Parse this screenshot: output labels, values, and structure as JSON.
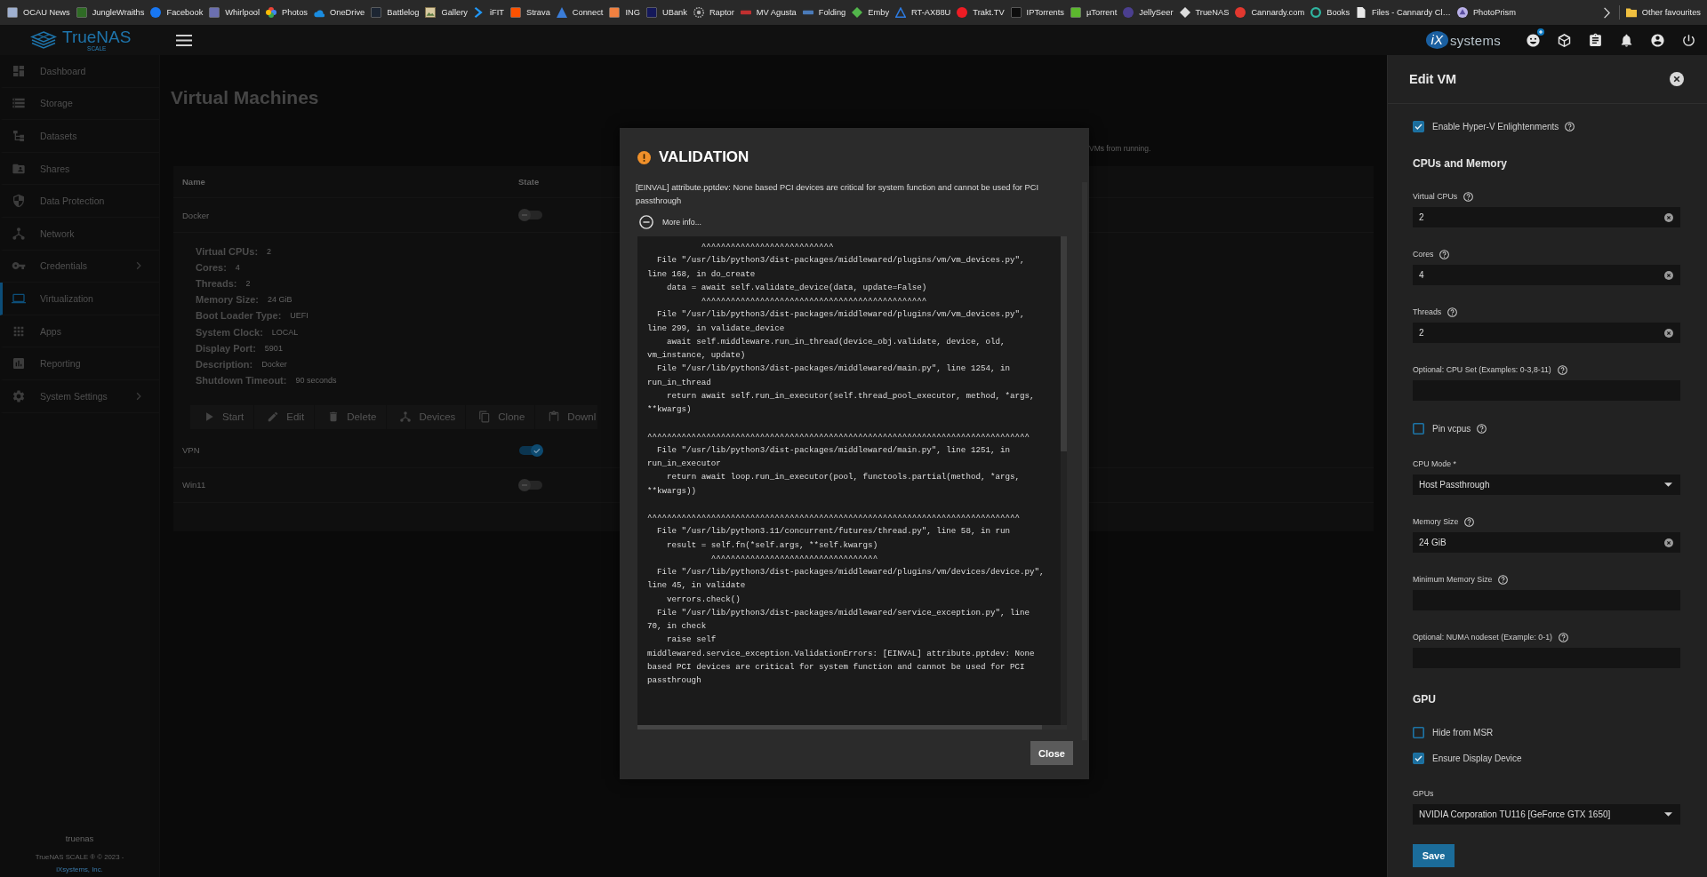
{
  "bookmarks": {
    "items": [
      "OCAU News",
      "JungleWraiths",
      "Facebook",
      "Whirlpool",
      "Photos",
      "OneDrive",
      "Battlelog",
      "Gallery",
      "iFIT",
      "Strava",
      "Connect",
      "ING",
      "UBank",
      "Raptor",
      "MV Agusta",
      "Folding",
      "Emby",
      "RT-AX88U",
      "Trakt.TV",
      "IPTorrents",
      "µTorrent",
      "JellySeer",
      "TrueNAS",
      "Cannardy.com",
      "Books",
      "Files - Cannardy Cl…",
      "PhotoPrism"
    ],
    "other": "Other favourites"
  },
  "topbar": {
    "logo": "TrueNAS",
    "edition": "SCALE",
    "vendor_mark": "iX",
    "vendor_name": "systems"
  },
  "sidebar": {
    "items": [
      {
        "label": "Dashboard",
        "selected": false,
        "expandable": false
      },
      {
        "label": "Storage",
        "selected": false,
        "expandable": false
      },
      {
        "label": "Datasets",
        "selected": false,
        "expandable": false
      },
      {
        "label": "Shares",
        "selected": false,
        "expandable": false
      },
      {
        "label": "Data Protection",
        "selected": false,
        "expandable": false
      },
      {
        "label": "Network",
        "selected": false,
        "expandable": false
      },
      {
        "label": "Credentials",
        "selected": false,
        "expandable": true
      },
      {
        "label": "Virtualization",
        "selected": true,
        "expandable": false
      },
      {
        "label": "Apps",
        "selected": false,
        "expandable": false
      },
      {
        "label": "Reporting",
        "selected": false,
        "expandable": false
      },
      {
        "label": "System Settings",
        "selected": false,
        "expandable": true
      }
    ],
    "footer": {
      "hostname": "truenas",
      "copyright": "TrueNAS SCALE ® © 2023 -",
      "company_link": "iXsystems, Inc."
    }
  },
  "page": {
    "title": "Virtual Machines",
    "note": "VMs from running.",
    "table": {
      "columns": [
        "Name",
        "State"
      ],
      "rows": [
        {
          "name": "Docker",
          "running": false,
          "details": [
            {
              "label": "Virtual CPUs:",
              "value": "2"
            },
            {
              "label": "Cores:",
              "value": "4"
            },
            {
              "label": "Threads:",
              "value": "2"
            },
            {
              "label": "Memory Size:",
              "value": "24 GiB"
            },
            {
              "label": "Boot Loader Type:",
              "value": "UEFI"
            },
            {
              "label": "System Clock:",
              "value": "LOCAL"
            },
            {
              "label": "Display Port:",
              "value": "5901"
            },
            {
              "label": "Description:",
              "value": "Docker"
            },
            {
              "label": "Shutdown Timeout:",
              "value": "90 seconds"
            }
          ],
          "actions": [
            "Start",
            "Edit",
            "Delete",
            "Devices",
            "Clone",
            "Downl"
          ]
        },
        {
          "name": "VPN",
          "running": true
        },
        {
          "name": "Win11",
          "running": false
        }
      ]
    }
  },
  "dialog": {
    "title": "VALIDATION",
    "message": "[EINVAL] attribute.pptdev: None based PCI devices are critical for system function and cannot be used for PCI passthrough",
    "more_info": {
      "label": "More info...",
      "expanded": true
    },
    "trace": "           ^^^^^^^^^^^^^^^^^^^^^^^^^^^\n  File \"/usr/lib/python3/dist-packages/middlewared/plugins/vm/vm_devices.py\", line 168, in do_create\n    data = await self.validate_device(data, update=False)\n           ^^^^^^^^^^^^^^^^^^^^^^^^^^^^^^^^^^^^^^^^^^^^^^\n  File \"/usr/lib/python3/dist-packages/middlewared/plugins/vm/vm_devices.py\", line 299, in validate_device\n    await self.middleware.run_in_thread(device_obj.validate, device, old, vm_instance, update)\n  File \"/usr/lib/python3/dist-packages/middlewared/main.py\", line 1254, in run_in_thread\n    return await self.run_in_executor(self.thread_pool_executor, method, *args, **kwargs)\n           ^^^^^^^^^^^^^^^^^^^^^^^^^^^^^^^^^^^^^^^^^^^^^^^^^^^^^^^^^^^^^^^^^^^^^^^^^^^^^^\n  File \"/usr/lib/python3/dist-packages/middlewared/main.py\", line 1251, in run_in_executor\n    return await loop.run_in_executor(pool, functools.partial(method, *args, **kwargs))\n           ^^^^^^^^^^^^^^^^^^^^^^^^^^^^^^^^^^^^^^^^^^^^^^^^^^^^^^^^^^^^^^^^^^^^^^^^^^^^\n  File \"/usr/lib/python3.11/concurrent/futures/thread.py\", line 58, in run\n    result = self.fn(*self.args, **self.kwargs)\n             ^^^^^^^^^^^^^^^^^^^^^^^^^^^^^^^^^^\n  File \"/usr/lib/python3/dist-packages/middlewared/plugins/vm/devices/device.py\", line 45, in validate\n    verrors.check()\n  File \"/usr/lib/python3/dist-packages/middlewared/service_exception.py\", line 70, in check\n    raise self\nmiddlewared.service_exception.ValidationErrors: [EINVAL] attribute.pptdev: None based PCI devices are critical for system function and cannot be used for PCI passthrough",
    "button": "Close"
  },
  "panel": {
    "title": "Edit VM",
    "fields": [
      {
        "kind": "checkbox",
        "label": "Enable Hyper-V Enlightenments",
        "checked": true,
        "help": true
      },
      {
        "kind": "heading",
        "label": "CPUs and Memory"
      },
      {
        "kind": "input",
        "label": "Virtual CPUs",
        "value": "2",
        "help": true,
        "clearable": true
      },
      {
        "kind": "input",
        "label": "Cores",
        "value": "4",
        "help": true,
        "clearable": true
      },
      {
        "kind": "input",
        "label": "Threads",
        "value": "2",
        "help": true,
        "clearable": true
      },
      {
        "kind": "input",
        "label": "Optional: CPU Set (Examples: 0-3,8-11)",
        "help": true,
        "clearable": false
      },
      {
        "kind": "checkbox",
        "label": "Pin vcpus",
        "checked": false,
        "help": true
      },
      {
        "kind": "select",
        "label": "CPU Mode *",
        "value": "Host Passthrough",
        "help": false
      },
      {
        "kind": "input",
        "label": "Memory Size",
        "value": "24 GiB",
        "help": true,
        "clearable": true
      },
      {
        "kind": "input",
        "label": "Minimum Memory Size",
        "help": true,
        "clearable": false
      },
      {
        "kind": "input",
        "label": "Optional: NUMA nodeset (Example: 0-1)",
        "help": true,
        "clearable": false
      },
      {
        "kind": "heading",
        "label": "GPU"
      },
      {
        "kind": "checkbox",
        "label": "Hide from MSR",
        "checked": false,
        "help": false
      },
      {
        "kind": "checkbox",
        "label": "Ensure Display Device",
        "checked": true,
        "help": false
      },
      {
        "kind": "select",
        "label": "GPUs",
        "value": "NVIDIA Corporation TU116 [GeForce GTX 1650]",
        "help": false
      }
    ],
    "save": "Save"
  }
}
